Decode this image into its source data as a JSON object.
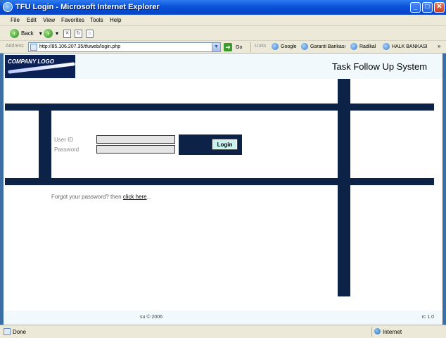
{
  "window": {
    "title": "TFU Login - Microsoft Internet Explorer",
    "minimize": "_",
    "maximize": "□",
    "close": "✕"
  },
  "menu": [
    "File",
    "Edit",
    "View",
    "Favorites",
    "Tools",
    "Help"
  ],
  "toolbar": {
    "back_label": "Back",
    "back_dropdown": "▾",
    "forward_dropdown": "▾"
  },
  "address": {
    "label": "Address",
    "url": "http://85.106.207.35/tfuweb/login.php",
    "go_label": "Go",
    "links_label": "Links",
    "links": [
      "Google",
      "Garanti Bankası",
      "Radikal",
      "HALK BANKASI"
    ]
  },
  "page": {
    "logo_text": "COMPANY LOGO",
    "system_title": "Task Follow Up System",
    "login_form": {
      "userid_label": "User ID",
      "password_label": "Password",
      "userid_value": "",
      "password_value": "",
      "login_button": "Login"
    },
    "forgot_text": "Forgot your password? then",
    "forgot_link": "click here",
    "forgot_trailing": "...",
    "copyright": "su © 2006",
    "version": "rc 1.0"
  },
  "status": {
    "text": "Done",
    "zone": "Internet"
  },
  "colors": {
    "navy": "#0c2247",
    "titlebar": "#0a52d8",
    "login_button": "#c7f3ef"
  }
}
